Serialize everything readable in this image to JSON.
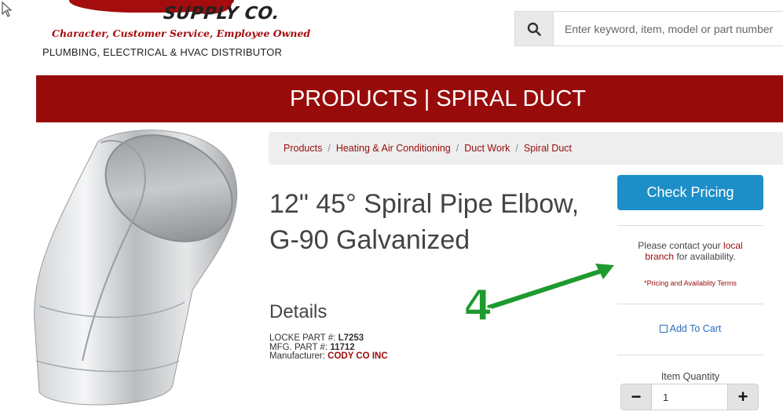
{
  "header": {
    "logo_word": "SUPPLY CO.",
    "logo_tagline": "Character, Customer Service, Employee Owned",
    "logo_subtitle": "PLUMBING, ELECTRICAL & HVAC DISTRIBUTOR"
  },
  "search": {
    "placeholder": "Enter keyword, item, model or part number",
    "icon": "search-icon"
  },
  "banner": {
    "title": "PRODUCTS | SPIRAL DUCT"
  },
  "breadcrumb": {
    "items": [
      "Products",
      "Heating & Air Conditioning",
      "Duct Work",
      "Spiral Duct"
    ],
    "separator": "/"
  },
  "product": {
    "title": "12\" 45° Spiral Pipe Elbow, G-90 Galvanized",
    "details_heading": "Details",
    "locke_part_label": "LOCKE PART #:",
    "locke_part_value": "L7253",
    "mfg_part_label": "MFG. PART #:",
    "mfg_part_value": "11712",
    "manufacturer_label": "Manufacturer:",
    "manufacturer_value": "CODY CO INC"
  },
  "sidebar": {
    "check_pricing_label": "Check Pricing",
    "contact_prefix": "Please contact your",
    "contact_link_1": "local",
    "contact_link_2": "branch",
    "contact_suffix": "for availability.",
    "terms_link": "*Pricing and Availablity Terms",
    "add_to_cart_label": "Add To Cart",
    "quantity_label": "Item Quantity",
    "quantity_value": "1",
    "minus_label": "−",
    "plus_label": "+"
  },
  "annotation": {
    "label": "4",
    "color": "#1e9a2e"
  },
  "colors": {
    "brand_red": "#980b0b",
    "button_blue": "#1d8fc8",
    "link_blue": "#2a6ebd"
  }
}
